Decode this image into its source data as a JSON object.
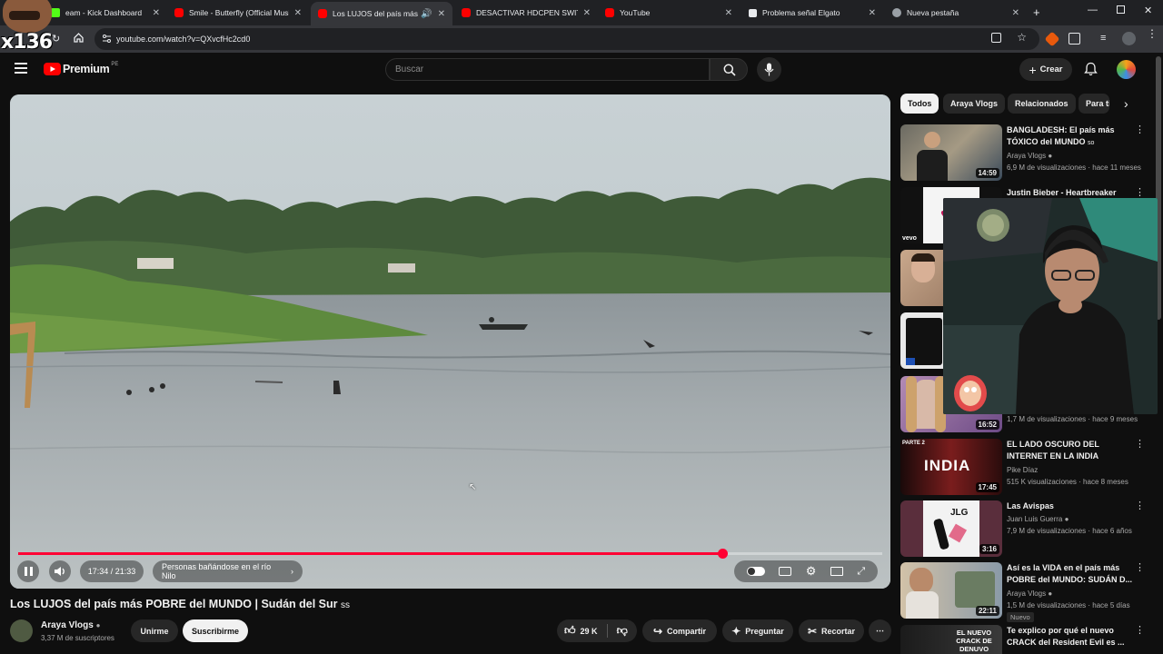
{
  "browser": {
    "tabs": [
      {
        "label": "eam - Kick Dashboard",
        "favicon": "kick-icon"
      },
      {
        "label": "Smile - Butterfly (Official Music",
        "favicon": "youtube-icon"
      },
      {
        "label": "Los LUJOS del país más PO",
        "favicon": "youtube-icon",
        "active": true
      },
      {
        "label": "DESACTIVAR HDCPEN SWITCH",
        "favicon": "youtube-icon"
      },
      {
        "label": "YouTube",
        "favicon": "youtube-icon"
      },
      {
        "label": "Problema señal Elgato",
        "favicon": "page-icon"
      },
      {
        "label": "Nueva pestaña",
        "favicon": "chrome-icon"
      }
    ],
    "new_tab": "+",
    "url": "youtube.com/watch?v=QXvcfHc2cd0"
  },
  "overlay": {
    "counter_text": "x136"
  },
  "header": {
    "logo_text": "Premium",
    "region": "PE",
    "search_placeholder": "Buscar",
    "create_label": "Crear"
  },
  "player": {
    "time_current": "17:34",
    "time_separator": "/",
    "time_total": "21:33",
    "time_display": "17:34 / 21:33",
    "chapter_label": "Personas bañándose en el río Nilo",
    "progress_fraction": 0.815,
    "accent_color": "#ff0033"
  },
  "video": {
    "title": "Los LUJOS del país más POBRE del MUNDO | Sudán del Sur",
    "title_suffix": "ss",
    "channel": "Araya Vlogs",
    "subscribers": "3,37 M de suscriptores",
    "join_label": "Unirme",
    "subscribe_label": "Suscribirme",
    "likes": "29 K",
    "share_label": "Compartir",
    "ask_label": "Preguntar",
    "clip_label": "Recortar"
  },
  "chips": [
    "Todos",
    "Araya Vlogs",
    "Relacionados",
    "Para ti"
  ],
  "recommendations": [
    {
      "title": "BANGLADESH: El país más TÓXICO del MUNDO",
      "title_suffix": "so",
      "channel": "Araya Vlogs",
      "meta": "6,9 M de visualizaciones · hace 11 meses",
      "duration": "14:59"
    },
    {
      "title": "Justin Bieber - Heartbreaker",
      "channel": "",
      "meta": "",
      "duration": "",
      "label": "vevo"
    },
    {
      "title": "",
      "channel": "",
      "meta": "",
      "duration": ""
    },
    {
      "title": "",
      "channel": "",
      "meta": "",
      "duration": ""
    },
    {
      "title": "",
      "channel": "",
      "meta": "1,7 M de visualizaciones · hace 9 meses",
      "duration": "16:52"
    },
    {
      "title": "EL LADO OSCURO DEL INTERNET EN LA INDIA",
      "channel": "Pike Díaz",
      "meta": "515 K visualizaciones · hace 8 meses",
      "duration": "17:45",
      "thumb_text": "INDIA",
      "thumb_tag": "PARTE 2"
    },
    {
      "title": "Las Avispas",
      "channel": "Juan Luis Guerra",
      "meta": "7,9 M de visualizaciones · hace 6 años",
      "duration": "3:16",
      "thumb_text": "JLG"
    },
    {
      "title": "Así es la VIDA en el país más POBRE del MUNDO: SUDÁN D...",
      "channel": "Araya Vlogs",
      "meta": "1,5 M de visualizaciones · hace 5 días",
      "duration": "22:11",
      "badge": "Nuevo"
    },
    {
      "title": "Te explico por qué el nuevo CRACK del Resident Evil es ...",
      "channel": "",
      "meta": "",
      "duration": "",
      "thumb_text": "EL NUEVO CRACK DE DENUVO"
    }
  ]
}
